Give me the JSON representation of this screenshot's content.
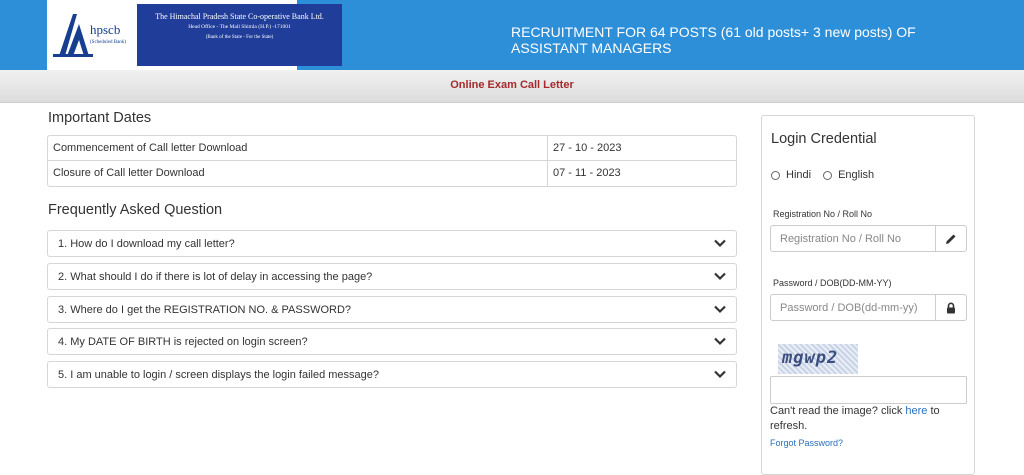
{
  "header": {
    "logo_text": "hpscb",
    "logo_subtext": "(Scheduled Bank)",
    "bank_name": "The Himachal Pradesh State Co-operative Bank Ltd.",
    "bank_address": "Head Office - The Mall Shimla (H.P.) -171001",
    "bank_tagline": "(Bank of the State - For the State)",
    "title_line1": "RECRUITMENT FOR 64 POSTS (61 old posts+ 3 new posts) OF",
    "title_line2": "ASSISTANT MANAGERS"
  },
  "subbar": {
    "label": "Online Exam Call Letter"
  },
  "dates": {
    "heading": "Important Dates",
    "rows": [
      {
        "label": "Commencement of Call letter Download",
        "value": "27 - 10 - 2023"
      },
      {
        "label": "Closure of Call letter Download",
        "value": "07 - 11 - 2023"
      }
    ]
  },
  "faq": {
    "heading": "Frequently Asked Question",
    "items": [
      "1. How do I download my call letter?",
      "2. What should I do if there is lot of delay in accessing the page?",
      "3. Where do I get the REGISTRATION NO. & PASSWORD?",
      "4. My DATE OF BIRTH is rejected on login screen?",
      "5. I am unable to login / screen displays the login failed message?"
    ]
  },
  "login": {
    "title": "Login Credential",
    "lang_options": [
      "Hindi",
      "English"
    ],
    "reg_label": "Registration No / Roll No",
    "reg_placeholder": "Registration No / Roll No",
    "pwd_label": "Password / DOB(DD-MM-YY)",
    "pwd_placeholder": "Password / DOB(dd-mm-yy)",
    "captcha_text": "mgwp2",
    "help_prefix": "Can't read the image? click ",
    "help_link": "here",
    "help_suffix": " to refresh.",
    "forgot": "Forgot Password?"
  },
  "colors": {
    "header_bg": "#2e8fd9",
    "logo_blue": "#1f3d99",
    "subbar_text": "#a52a2a",
    "link": "#2a6ebb"
  },
  "icons": [
    "chevron-down-icon",
    "pencil-icon",
    "lock-icon"
  ]
}
